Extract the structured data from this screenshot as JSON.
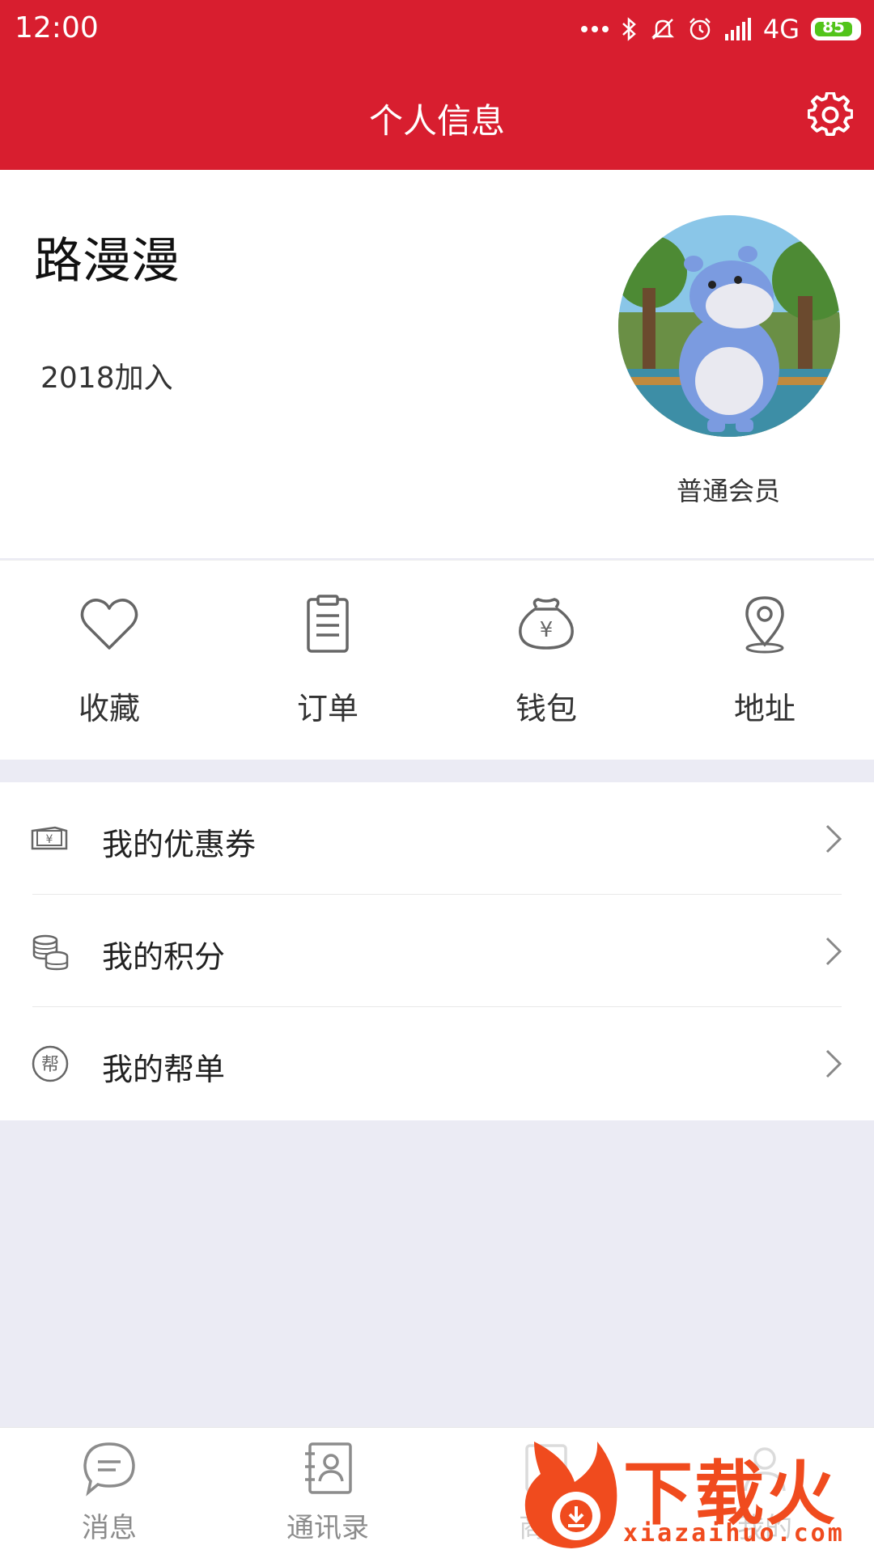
{
  "status_bar": {
    "time": "12:00",
    "network": "4G",
    "battery_level": "85"
  },
  "header": {
    "title": "个人信息",
    "settings_icon": "gear-icon"
  },
  "profile": {
    "name": "路漫漫",
    "joined": "2018加入",
    "member_level": "普通会员",
    "avatar_icon": "hippo-avatar"
  },
  "quick_actions": [
    {
      "label": "收藏",
      "icon": "heart-icon"
    },
    {
      "label": "订单",
      "icon": "clipboard-icon"
    },
    {
      "label": "钱包",
      "icon": "money-bag-icon"
    },
    {
      "label": "地址",
      "icon": "location-pin-icon"
    }
  ],
  "menu_items": [
    {
      "label": "我的优惠券",
      "icon": "coupon-icon"
    },
    {
      "label": "我的积分",
      "icon": "coins-icon"
    },
    {
      "label": "我的帮单",
      "icon": "help-order-icon",
      "icon_text": "帮"
    }
  ],
  "tabbar": [
    {
      "label": "消息",
      "icon": "chat-bubble-icon"
    },
    {
      "label": "通讯录",
      "icon": "contacts-icon"
    },
    {
      "label": "商城",
      "icon": "shop-icon"
    },
    {
      "label": "我的",
      "icon": "user-icon"
    }
  ],
  "watermark": {
    "title": "下载火",
    "url": "xiazaihuo.com"
  },
  "colors": {
    "brand_red": "#d81e2f",
    "background": "#ebebf4",
    "watermark_orange": "#f04b1e"
  }
}
